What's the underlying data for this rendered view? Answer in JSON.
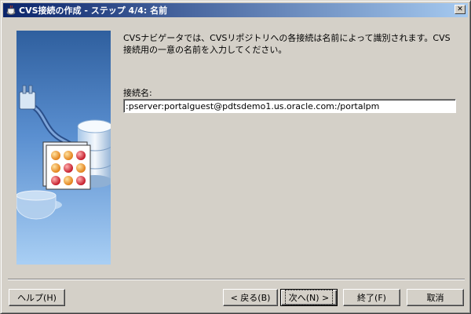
{
  "window": {
    "title": "CVS接続の作成 - ステップ 4/4: 名前",
    "close_glyph": "✕"
  },
  "main": {
    "description": "CVSナビゲータでは、CVSリポジトリへの各接続は名前によって識別されます。CVS接続用の一意の名前を入力してください。",
    "connection_name": {
      "label": "接続名:",
      "value": ":pserver:portalguest@pdtsdemo1.us.oracle.com:/portalpm"
    }
  },
  "buttons": {
    "help": "ヘルプ(H)",
    "back": "< 戻る(B)",
    "next": "次へ(N) >",
    "finish": "終了(F)",
    "cancel": "取消"
  },
  "colors": {
    "titlebar_start": "#0a246a",
    "titlebar_end": "#a6caf0",
    "dialog_face": "#d4d0c8"
  }
}
